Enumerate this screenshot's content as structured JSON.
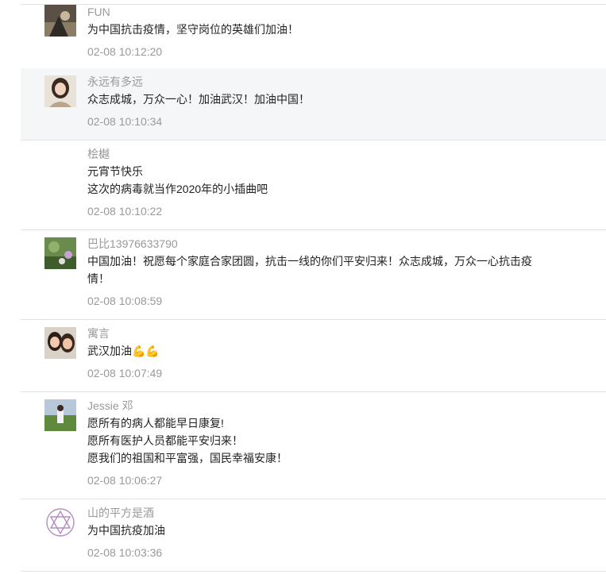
{
  "comments": [
    {
      "user": "FUN",
      "lines": [
        "为中国抗击疫情，坚守岗位的英雄们加油！"
      ],
      "time": "02-08 10:12:20",
      "avatar": "avatar-1"
    },
    {
      "user": "永远有多远",
      "lines": [
        "众志成城，万众一心！加油武汉！加油中国！"
      ],
      "time": "02-08 10:10:34",
      "avatar": "avatar-2",
      "highlight": true
    },
    {
      "user": "桧樾",
      "lines": [
        "元宵节快乐",
        "这次的病毒就当作2020年的小插曲吧"
      ],
      "time": "02-08 10:10:22",
      "avatar": ""
    },
    {
      "user": "巴比13976633790",
      "lines": [
        "中国加油！祝愿每个家庭合家团圆，抗击一线的你们平安归来！众志成城，万众一心抗击疫",
        "情！"
      ],
      "time": "02-08 10:08:59",
      "avatar": "avatar-3"
    },
    {
      "user": "寓言",
      "lines": [
        "武汉加油💪💪"
      ],
      "time": "02-08 10:07:49",
      "avatar": "avatar-4"
    },
    {
      "user": "Jessie 邓",
      "lines": [
        "愿所有的病人都能早日康复!",
        "愿所有医护人员都能平安归来！",
        "愿我们的祖国和平富强，国民幸福安康！"
      ],
      "time": "02-08 10:06:27",
      "avatar": "avatar-5"
    },
    {
      "user": "山的平方是酒",
      "lines": [
        "为中国抗疫加油"
      ],
      "time": "02-08 10:03:36",
      "avatar": "avatar-6"
    }
  ]
}
